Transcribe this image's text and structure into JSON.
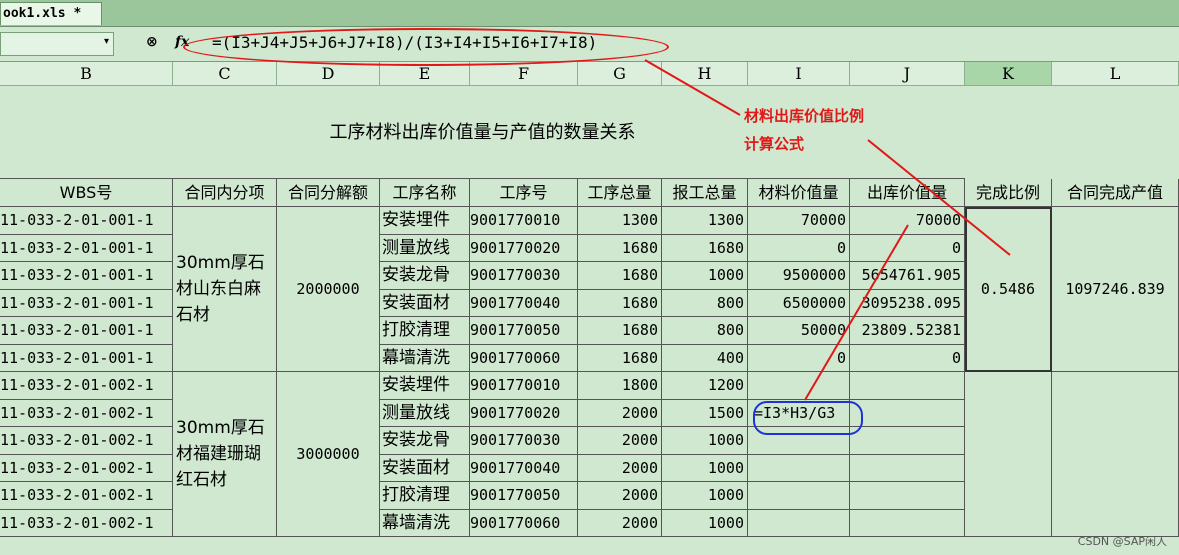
{
  "tab": {
    "title": "ook1.xls *"
  },
  "formula_bar": {
    "name_box": "",
    "fx_label": "fx",
    "formula": "=(I3+J4+J5+J6+J7+I8)/(I3+I4+I5+I6+I7+I8)"
  },
  "columns": [
    "B",
    "C",
    "D",
    "E",
    "F",
    "G",
    "H",
    "I",
    "J",
    "K",
    "L"
  ],
  "sheet_title": "工序材料出库价值量与产值的数量关系",
  "headers": [
    "WBS号",
    "合同内分项",
    "合同分解额",
    "工序名称",
    "工序号",
    "工序总量",
    "报工总量",
    "材料价值量",
    "出库价值量",
    "完成比例",
    "合同完成产值"
  ],
  "groups": [
    {
      "item": "30mm厚石材山东白麻石材",
      "amount": "2000000",
      "ratio": "0.5486",
      "completed_value": "1097246.839",
      "rows": [
        {
          "wbs": "11-033-2-01-001-1",
          "proc": "安装埋件",
          "code": "9001770010",
          "total": "1300",
          "reported": "1300",
          "material": "70000",
          "out": "70000"
        },
        {
          "wbs": "11-033-2-01-001-1",
          "proc": "测量放线",
          "code": "9001770020",
          "total": "1680",
          "reported": "1680",
          "material": "0",
          "out": "0"
        },
        {
          "wbs": "11-033-2-01-001-1",
          "proc": "安装龙骨",
          "code": "9001770030",
          "total": "1680",
          "reported": "1000",
          "material": "9500000",
          "out": "5654761.905"
        },
        {
          "wbs": "11-033-2-01-001-1",
          "proc": "安装面材",
          "code": "9001770040",
          "total": "1680",
          "reported": "800",
          "material": "6500000",
          "out": "3095238.095"
        },
        {
          "wbs": "11-033-2-01-001-1",
          "proc": "打胶清理",
          "code": "9001770050",
          "total": "1680",
          "reported": "800",
          "material": "50000",
          "out": "23809.52381"
        },
        {
          "wbs": "11-033-2-01-001-1",
          "proc": "幕墙清洗",
          "code": "9001770060",
          "total": "1680",
          "reported": "400",
          "material": "0",
          "out": "0"
        }
      ]
    },
    {
      "item": "30mm厚石材福建珊瑚红石材",
      "amount": "3000000",
      "ratio": "",
      "completed_value": "",
      "rows": [
        {
          "wbs": "11-033-2-01-002-1",
          "proc": "安装埋件",
          "code": "9001770010",
          "total": "1800",
          "reported": "1200",
          "material": "",
          "out": ""
        },
        {
          "wbs": "11-033-2-01-002-1",
          "proc": "测量放线",
          "code": "9001770020",
          "total": "2000",
          "reported": "1500",
          "material": "=I3*H3/G3",
          "out": ""
        },
        {
          "wbs": "11-033-2-01-002-1",
          "proc": "安装龙骨",
          "code": "9001770030",
          "total": "2000",
          "reported": "1000",
          "material": "",
          "out": ""
        },
        {
          "wbs": "11-033-2-01-002-1",
          "proc": "安装面材",
          "code": "9001770040",
          "total": "2000",
          "reported": "1000",
          "material": "",
          "out": ""
        },
        {
          "wbs": "11-033-2-01-002-1",
          "proc": "打胶清理",
          "code": "9001770050",
          "total": "2000",
          "reported": "1000",
          "material": "",
          "out": ""
        },
        {
          "wbs": "11-033-2-01-002-1",
          "proc": "幕墙清洗",
          "code": "9001770060",
          "total": "2000",
          "reported": "1000",
          "material": "",
          "out": ""
        }
      ]
    }
  ],
  "annotation": {
    "line1": "材料出库价值比例",
    "line2": "计算公式"
  },
  "watermark": "CSDN @SAP闲人",
  "colors": {
    "annotation_red": "#e01818",
    "annotation_blue": "#1e34d6",
    "sheet_bg": "#cfe8cf"
  }
}
